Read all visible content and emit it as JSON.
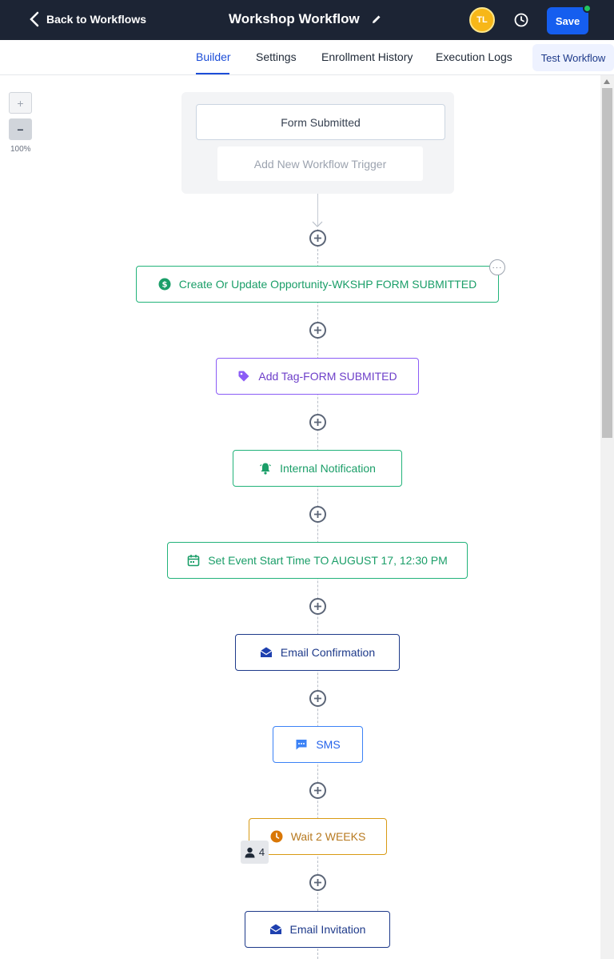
{
  "header": {
    "back_label": "Back to Workflows",
    "title": "Workshop Workflow",
    "avatar_initials": "TL",
    "save_label": "Save"
  },
  "tabs": [
    {
      "label": "Builder",
      "active": true
    },
    {
      "label": "Settings",
      "active": false
    },
    {
      "label": "Enrollment History",
      "active": false
    },
    {
      "label": "Execution Logs",
      "active": false
    }
  ],
  "test_workflow_label": "Test Workflow",
  "zoom": {
    "in_label": "+",
    "out_label": "−",
    "level": "100%"
  },
  "trigger": {
    "label": "Form Submitted",
    "add_label": "Add New Workflow Trigger"
  },
  "actions": [
    {
      "label": "Create Or Update Opportunity-WKSHP FORM SUBMITTED",
      "icon": "dollar-icon",
      "color": "#1a9e68"
    },
    {
      "label": "Add Tag-FORM SUBMITED",
      "icon": "tag-icon",
      "color": "#8b5cf6"
    },
    {
      "label": "Internal Notification",
      "icon": "bell-icon",
      "color": "#1a9e68"
    },
    {
      "label": "Set Event Start Time TO AUGUST 17, 12:30 PM",
      "icon": "calendar-icon",
      "color": "#1a9e68"
    },
    {
      "label": "Email Confirmation",
      "icon": "envelope-icon",
      "color": "#1e3a8a"
    },
    {
      "label": "SMS",
      "icon": "chat-icon",
      "color": "#2563eb"
    },
    {
      "label": "Wait 2 WEEKS",
      "icon": "clock-icon",
      "color": "#d97706"
    },
    {
      "label": "Email Invitation",
      "icon": "envelope-icon",
      "color": "#1e3a8a"
    }
  ],
  "wait_count": "4",
  "more_label": "···",
  "colors": {
    "topbar": "#1c2434",
    "save": "#155eef",
    "accent": "#1d4ed8"
  }
}
